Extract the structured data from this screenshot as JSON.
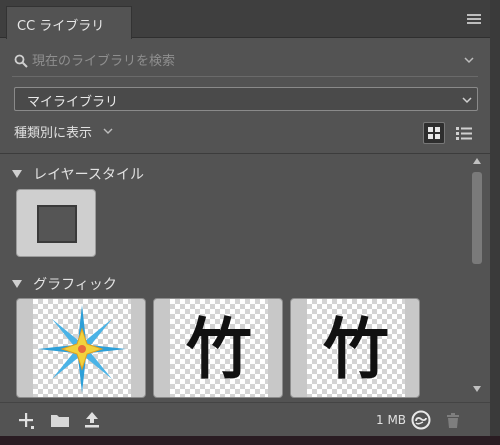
{
  "panel": {
    "tab_label": "CC ライブラリ",
    "menu_icon": "hamburger-menu-icon"
  },
  "search": {
    "placeholder": "現在のライブラリを検索",
    "value": ""
  },
  "library_selector": {
    "selected": "マイライブラリ"
  },
  "view_by": {
    "label": "種類別に表示",
    "grid_view_icon": "grid-view-icon",
    "list_view_icon": "list-view-icon",
    "active_view": "grid"
  },
  "sections": [
    {
      "title": "レイヤースタイル",
      "items": [
        {
          "kind": "layer-style",
          "icon": "layer-style-thumbnail"
        }
      ]
    },
    {
      "title": "グラフィック",
      "items": [
        {
          "kind": "graphic",
          "icon": "starburst-graphic"
        },
        {
          "kind": "graphic",
          "glyph": "竹"
        },
        {
          "kind": "graphic",
          "glyph": "竹"
        }
      ]
    }
  ],
  "footer": {
    "add_icon": "plus-icon",
    "folder_icon": "folder-icon",
    "upload_icon": "upload-icon",
    "storage_text": "1 MB",
    "sync_icon": "creative-cloud-sync-icon",
    "trash_icon": "trash-icon"
  },
  "colors": {
    "panel_bg": "#535353",
    "header_bg": "#3f3f3f",
    "accent_blue": "#2d9fd8",
    "accent_yellow": "#f2d23c"
  }
}
